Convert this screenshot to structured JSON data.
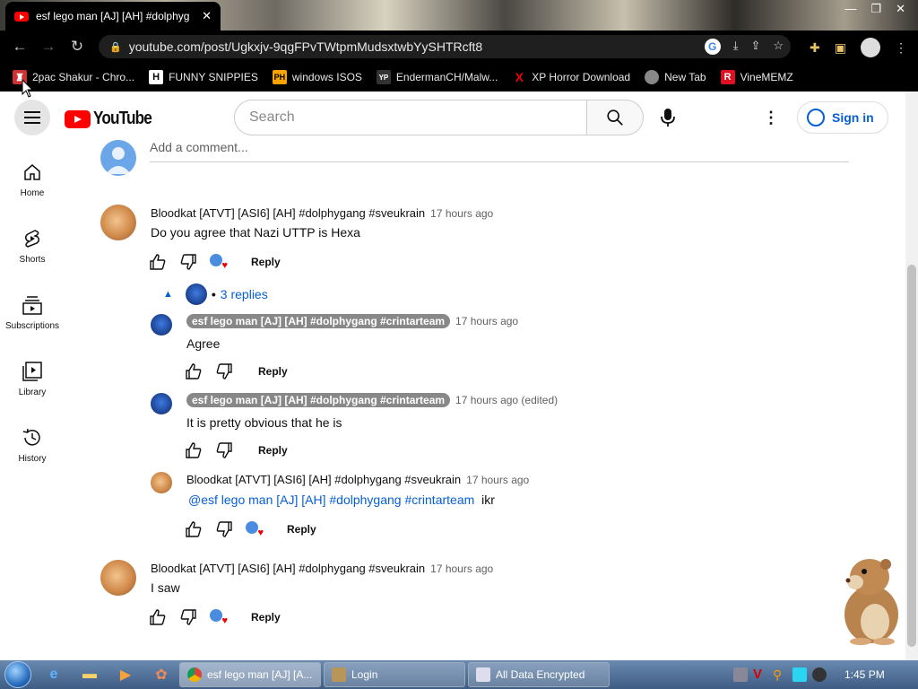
{
  "browser": {
    "tab_title": "esf lego man [AJ] [AH] #dolphyg",
    "url": "youtube.com/post/Ugkxjv-9qgFPvTWtpmMudsxtwbYySHTRcft8"
  },
  "bookmarks": [
    {
      "label": "2pac Shakur - Chro...",
      "icon": "2pac-icon",
      "color": "#c33"
    },
    {
      "label": "FUNNY SNIPPIES",
      "icon": "H",
      "color": "#222"
    },
    {
      "label": "windows ISOS",
      "icon": "PH",
      "color": "#f7a400"
    },
    {
      "label": "EndermanCH/Malw...",
      "icon": "YP",
      "color": "#333"
    },
    {
      "label": "XP Horror Download",
      "icon": "X",
      "color": "#e00"
    },
    {
      "label": "New Tab",
      "icon": "globe-icon",
      "color": "#888"
    },
    {
      "label": "VineMEMZ",
      "icon": "R",
      "color": "#d12"
    }
  ],
  "youtube": {
    "logo_text": "YouTube",
    "search_placeholder": "Search",
    "signin_label": "Sign in"
  },
  "sidenav": [
    {
      "label": "Home",
      "icon": "home-icon"
    },
    {
      "label": "Shorts",
      "icon": "shorts-icon"
    },
    {
      "label": "Subscriptions",
      "icon": "subscriptions-icon"
    },
    {
      "label": "Library",
      "icon": "library-icon"
    },
    {
      "label": "History",
      "icon": "history-icon"
    }
  ],
  "comments": {
    "add_comment_placeholder": "Add a comment...",
    "reply_label": "Reply",
    "thread1": {
      "author": "Bloodkat [ATVT] [ASI6] [AH] #dolphygang #sveukrain",
      "time": "17 hours ago",
      "text": "Do you agree that Nazi UTTP is Hexa",
      "replies_toggle": "3 replies",
      "replies": [
        {
          "author": "esf lego man [AJ] [AH] #dolphygang #crintarteam",
          "time": "17 hours ago",
          "text": "Agree"
        },
        {
          "author": "esf lego man [AJ] [AH] #dolphygang #crintarteam",
          "time": "17 hours ago (edited)",
          "text": "It is pretty obvious that he is"
        },
        {
          "author": "Bloodkat [ATVT] [ASI6] [AH] #dolphygang #sveukrain",
          "time": "17 hours ago",
          "mention": "@esf lego man [AJ] [AH] #dolphygang #crintarteam",
          "text": "ikr"
        }
      ]
    },
    "thread2": {
      "author": "Bloodkat [ATVT] [ASI6] [AH] #dolphygang #sveukrain",
      "time": "17 hours ago",
      "text": "I saw"
    }
  },
  "taskbar": {
    "windows": [
      {
        "label": "esf lego man [AJ] [A...",
        "active": true
      },
      {
        "label": "Login",
        "active": false
      },
      {
        "label": "All Data Encrypted",
        "active": false
      }
    ],
    "clock": "1:45 PM"
  },
  "colors": {
    "link": "#065fd4",
    "yt_red": "#ff0000"
  }
}
